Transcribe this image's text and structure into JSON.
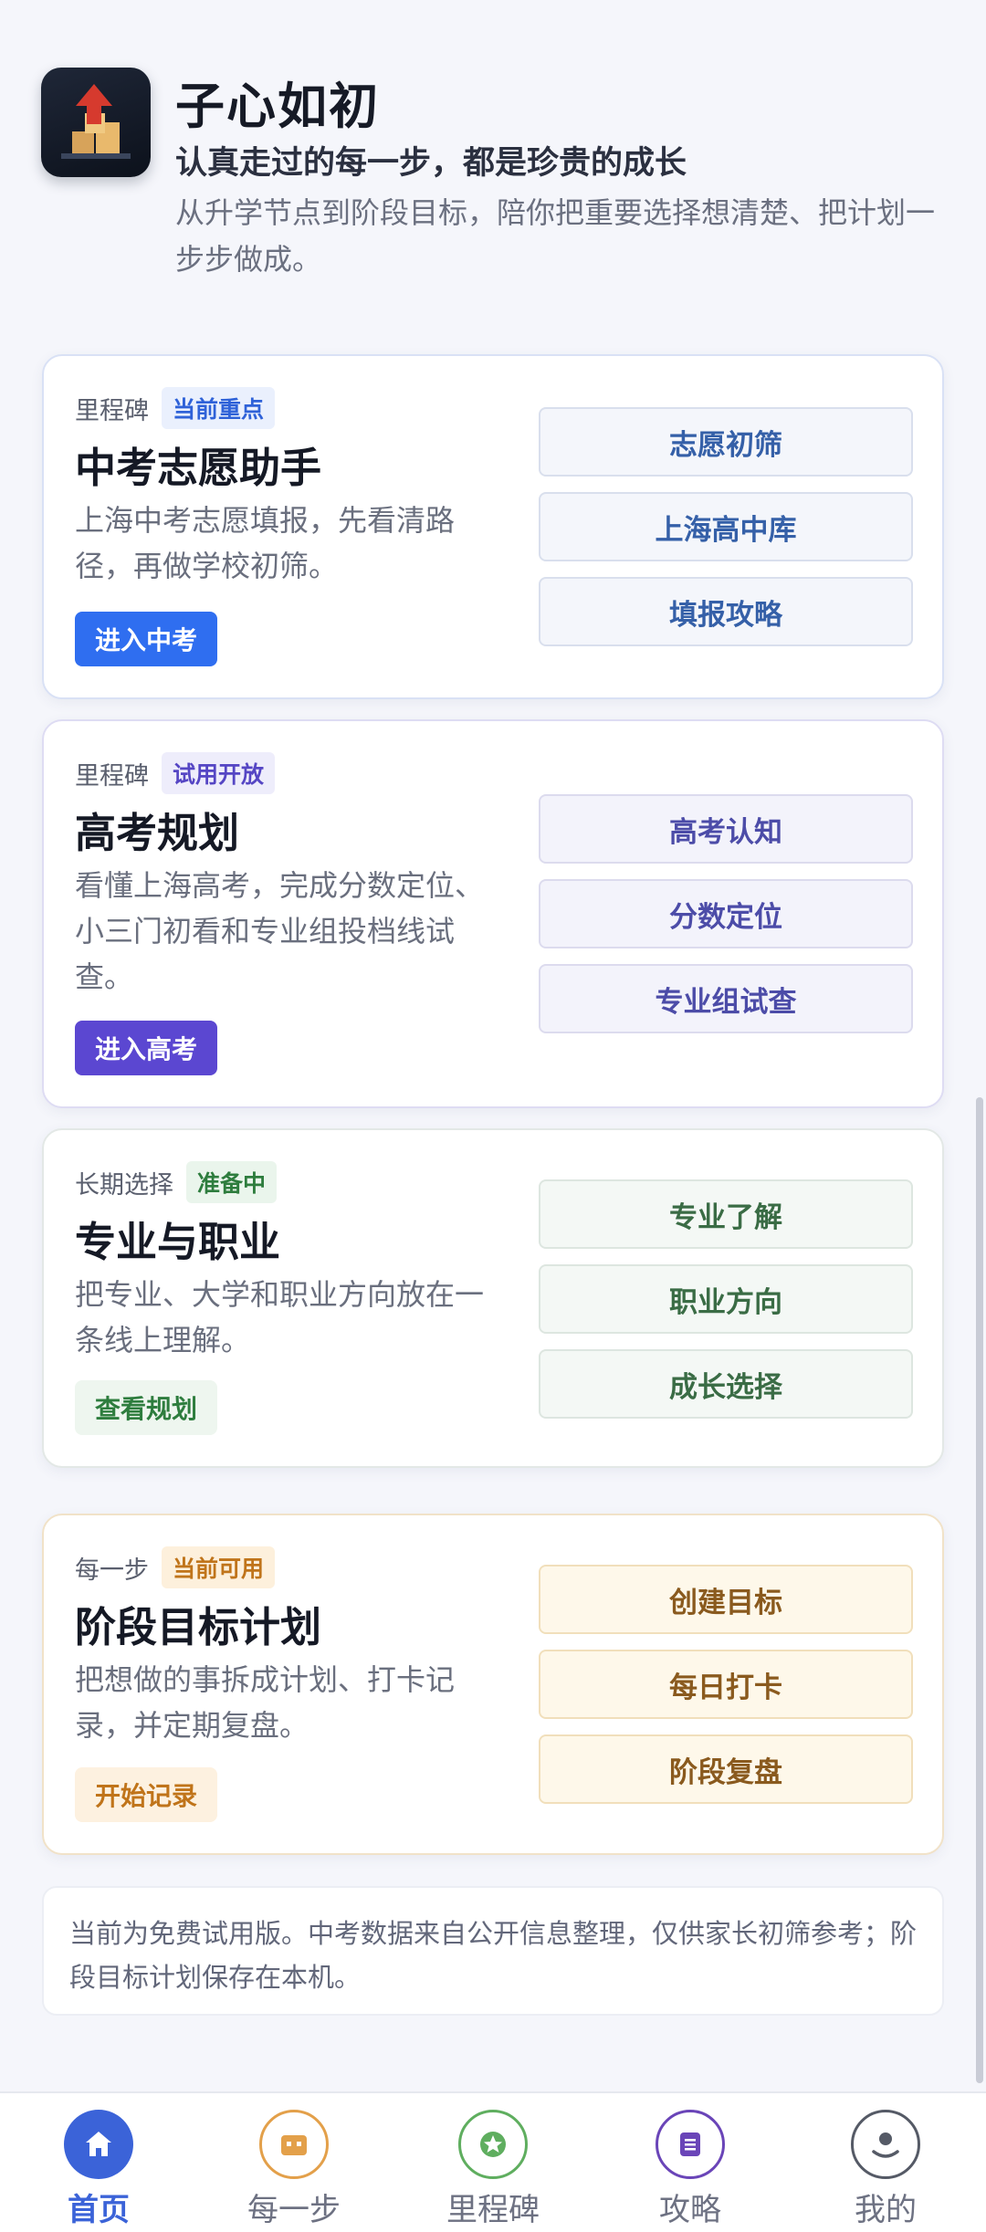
{
  "header": {
    "title": "子心如初",
    "slogan": "认真走过的每一步，都是珍贵的成长",
    "description": "从升学节点到阶段目标，陪你把重要选择想清楚、把计划一步步做成。"
  },
  "cards": [
    {
      "eyebrow": "里程碑",
      "badge": "当前重点",
      "title": "中考志愿助手",
      "description": "上海中考志愿填报，先看清路径，再做学校初筛。",
      "action": "进入中考",
      "shortcuts": [
        "志愿初筛",
        "上海高中库",
        "填报攻略"
      ]
    },
    {
      "eyebrow": "里程碑",
      "badge": "试用开放",
      "title": "高考规划",
      "description": "看懂上海高考，完成分数定位、小三门初看和专业组投档线试查。",
      "action": "进入高考",
      "shortcuts": [
        "高考认知",
        "分数定位",
        "专业组试查"
      ]
    },
    {
      "eyebrow": "长期选择",
      "badge": "准备中",
      "title": "专业与职业",
      "description": "把专业、大学和职业方向放在一条线上理解。",
      "action": "查看规划",
      "shortcuts": [
        "专业了解",
        "职业方向",
        "成长选择"
      ]
    },
    {
      "eyebrow": "每一步",
      "badge": "当前可用",
      "title": "阶段目标计划",
      "description": "把想做的事拆成计划、打卡记录，并定期复盘。",
      "action": "开始记录",
      "shortcuts": [
        "创建目标",
        "每日打卡",
        "阶段复盘"
      ]
    }
  ],
  "notice": "当前为免费试用版。中考数据来自公开信息整理，仅供家长初筛参考；阶段目标计划保存在本机。",
  "bottom_nav": [
    {
      "label": "首页",
      "icon": "home-icon",
      "active": true
    },
    {
      "label": "每一步",
      "icon": "steps-icon",
      "active": false
    },
    {
      "label": "里程碑",
      "icon": "star-icon",
      "active": false
    },
    {
      "label": "攻略",
      "icon": "guide-icon",
      "active": false
    },
    {
      "label": "我的",
      "icon": "profile-icon",
      "active": false
    }
  ],
  "colors": {
    "primary_blue": "#2f6ef0",
    "primary_purple": "#5b47d1",
    "accent_green": "#2e7d3e",
    "accent_orange": "#c0741a",
    "nav_active": "#3b63d8"
  }
}
